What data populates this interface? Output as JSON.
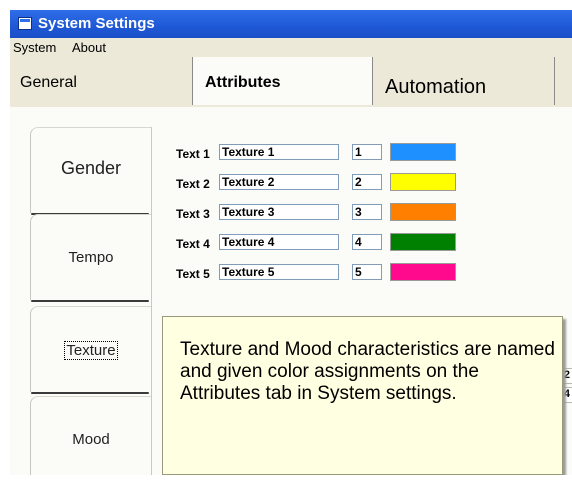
{
  "window": {
    "title": "System Settings"
  },
  "menu": {
    "items": [
      "System",
      "About"
    ]
  },
  "tabs": [
    {
      "label": "General",
      "selected": false
    },
    {
      "label": "Attributes",
      "selected": true
    },
    {
      "label": "Automation",
      "selected": false
    }
  ],
  "side_tabs": [
    {
      "label": "Gender"
    },
    {
      "label": "Tempo"
    },
    {
      "label": "Texture",
      "selected": true
    },
    {
      "label": "Mood"
    }
  ],
  "attributes": [
    {
      "label": "Text 1",
      "name": "Texture 1",
      "number": "1",
      "color": "#1e90ff"
    },
    {
      "label": "Text 2",
      "name": "Texture 2",
      "number": "2",
      "color": "#ffff00"
    },
    {
      "label": "Text 3",
      "name": "Texture 3",
      "number": "3",
      "color": "#ff8000"
    },
    {
      "label": "Text 4",
      "name": "Texture 4",
      "number": "4",
      "color": "#008000"
    },
    {
      "label": "Text 5",
      "name": "Texture 5",
      "number": "5",
      "color": "#ff0a8c"
    }
  ],
  "partial_labels": [
    "xt 2",
    "xt 4"
  ],
  "tooltip": {
    "text": "Texture and Mood characteristics are named and given color assignments on the Attributes tab in System settings."
  }
}
